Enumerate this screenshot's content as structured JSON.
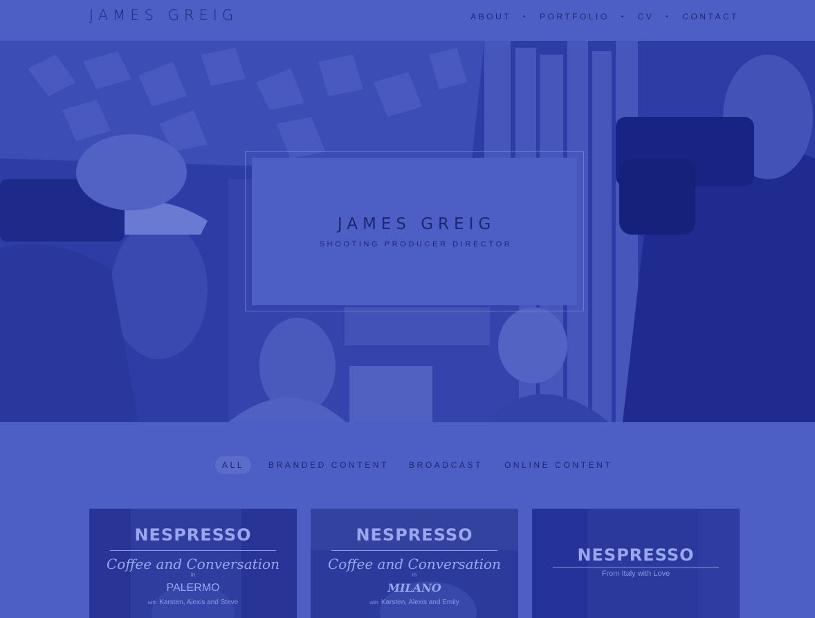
{
  "header": {
    "logo": "JAMES GREIG",
    "nav": [
      {
        "label": "ABOUT"
      },
      {
        "label": "PORTFOLIO"
      },
      {
        "label": "CV"
      },
      {
        "label": "CONTACT"
      }
    ],
    "separator": "•"
  },
  "hero": {
    "title": "JAMES GREIG",
    "subtitle": "SHOOTING PRODUCER DIRECTOR"
  },
  "filters": [
    {
      "label": "ALL",
      "active": true
    },
    {
      "label": "BRANDED CONTENT",
      "active": false
    },
    {
      "label": "BROADCAST",
      "active": false
    },
    {
      "label": "ONLINE CONTENT",
      "active": false
    }
  ],
  "cards": [
    {
      "brand": "NESPRESSO",
      "script": "Coffee and Conversation",
      "in": "in",
      "city": "PALERMO",
      "with_label": "with",
      "with_names": "Karsten, Alexis and Steve"
    },
    {
      "brand": "NESPRESSO",
      "script": "Coffee and Conversation",
      "in": "in",
      "city": "MILANO",
      "with_label": "with",
      "with_names": "Karsten, Alexis and Emily"
    },
    {
      "brand": "NESPRESSO",
      "tagline": "From Italy with Love"
    }
  ],
  "colors": {
    "background": "#4d5fc4",
    "text": "#1d2670",
    "hero_overlay": "#2a36a0"
  }
}
